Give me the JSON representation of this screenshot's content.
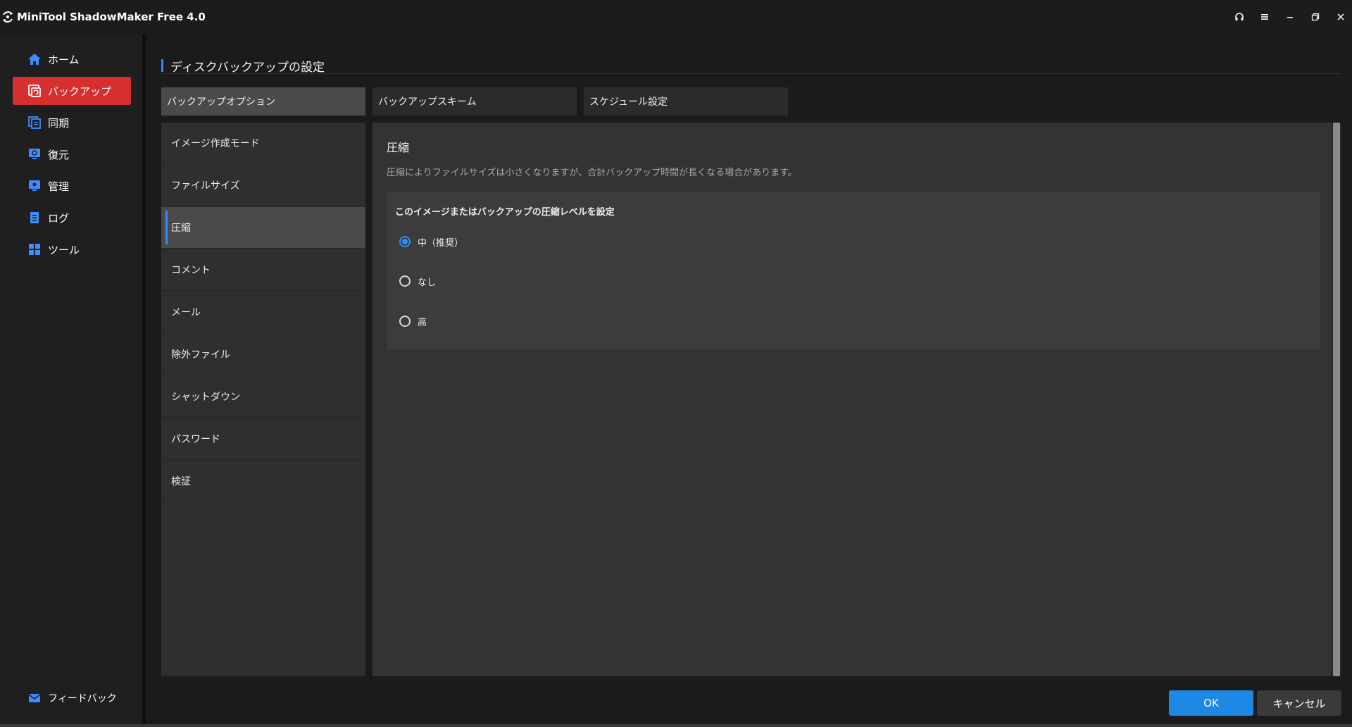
{
  "app": {
    "title": "MiniTool ShadowMaker Free 4.0"
  },
  "window_controls": [
    "headset-icon",
    "menu-icon",
    "minimize-icon",
    "restore-icon",
    "close-icon"
  ],
  "sidebar": {
    "items": [
      {
        "label": "ホーム",
        "icon": "home-icon",
        "active": false
      },
      {
        "label": "バックアップ",
        "icon": "backup-icon",
        "active": true
      },
      {
        "label": "同期",
        "icon": "sync-icon",
        "active": false
      },
      {
        "label": "復元",
        "icon": "restore-icon",
        "active": false
      },
      {
        "label": "管理",
        "icon": "manage-icon",
        "active": false
      },
      {
        "label": "ログ",
        "icon": "log-icon",
        "active": false
      },
      {
        "label": "ツール",
        "icon": "tools-icon",
        "active": false
      }
    ],
    "feedback": {
      "label": "フィードバック",
      "icon": "mail-icon"
    }
  },
  "page": {
    "title": "ディスクバックアップの設定",
    "tabs": [
      {
        "label": "バックアップオプション",
        "active": true
      },
      {
        "label": "バックアップスキーム",
        "active": false
      },
      {
        "label": "スケジュール設定",
        "active": false
      }
    ],
    "options": [
      {
        "label": "イメージ作成モード",
        "active": false
      },
      {
        "label": "ファイルサイズ",
        "active": false
      },
      {
        "label": "圧縮",
        "active": true
      },
      {
        "label": "コメント",
        "active": false
      },
      {
        "label": "メール",
        "active": false
      },
      {
        "label": "除外ファイル",
        "active": false
      },
      {
        "label": "シャットダウン",
        "active": false
      },
      {
        "label": "パスワード",
        "active": false
      },
      {
        "label": "検証",
        "active": false
      }
    ]
  },
  "content": {
    "title": "圧縮",
    "description": "圧縮によりファイルサイズは小さくなりますが、合計バックアップ時間が長くなる場合があります。",
    "level_title": "このイメージまたはバックアップの圧縮レベルを設定",
    "levels": [
      {
        "label": "中（推奨）",
        "checked": true
      },
      {
        "label": "なし",
        "checked": false
      },
      {
        "label": "高",
        "checked": false
      }
    ]
  },
  "buttons": {
    "ok": "OK",
    "cancel": "キャンセル"
  },
  "colors": {
    "accent_blue": "#2f8bff",
    "active_red": "#d62f2f",
    "ok_button": "#1e88e5"
  }
}
